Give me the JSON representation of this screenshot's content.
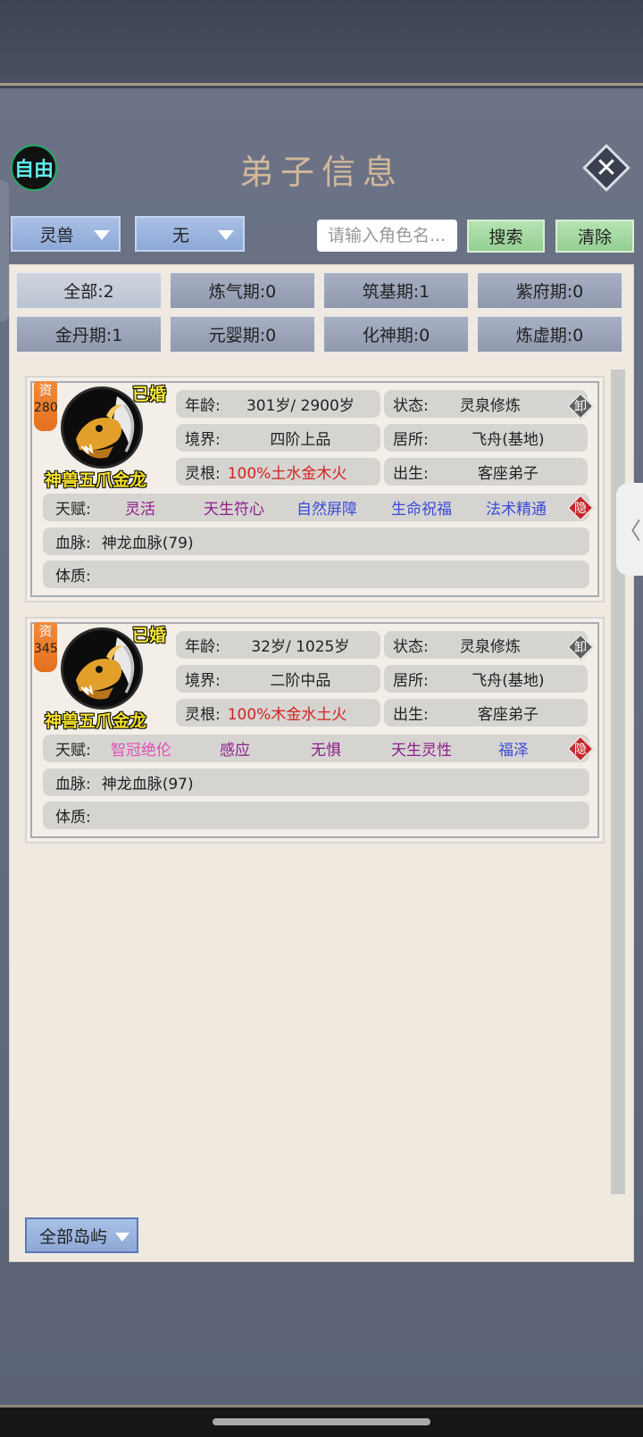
{
  "header": {
    "free_label": "自由",
    "title": "弟子信息",
    "close_label": "✕"
  },
  "filters": {
    "type_select": "灵兽",
    "second_select": "无",
    "search_placeholder": "请输入角色名...",
    "search_label": "搜索",
    "clear_label": "清除"
  },
  "realms": [
    {
      "label": "全部:2"
    },
    {
      "label": "炼气期:0"
    },
    {
      "label": "筑基期:1"
    },
    {
      "label": "紫府期:0"
    },
    {
      "label": "金丹期:1"
    },
    {
      "label": "元婴期:0"
    },
    {
      "label": "化神期:0"
    },
    {
      "label": "炼虚期:0"
    }
  ],
  "labels": {
    "age": "年龄:",
    "state": "状态:",
    "realm": "境界:",
    "residence": "居所:",
    "root": "灵根:",
    "birth": "出生:",
    "talent": "天赋:",
    "bloodline": "血脉:",
    "physique": "体质:",
    "unequip_badge": "卸",
    "hide_badge": "隐",
    "aptitude_prefix": "资",
    "married": "已婚"
  },
  "disciples": [
    {
      "aptitude": "280",
      "name": "神兽五爪金龙",
      "age": "301岁/ 2900岁",
      "state": "灵泉修炼",
      "realm": "四阶上品",
      "residence": "飞舟(基地)",
      "root": "100%土水金木火",
      "birth": "客座弟子",
      "talents": [
        "灵活",
        "天生符心",
        "自然屏障",
        "生命祝福",
        "法术精通"
      ],
      "talent_colors": [
        "purple",
        "purple",
        "blue",
        "blue",
        "blue"
      ],
      "bloodline": "神龙血脉(79)",
      "physique": ""
    },
    {
      "aptitude": "345",
      "name": "神兽五爪金龙",
      "age": "32岁/ 1025岁",
      "state": "灵泉修炼",
      "realm": "二阶中品",
      "residence": "飞舟(基地)",
      "root": "100%木金水土火",
      "birth": "客座弟子",
      "talents": [
        "智冠绝伦",
        "感应",
        "无惧",
        "天生灵性",
        "福泽"
      ],
      "talent_colors": [
        "pink",
        "purple",
        "purple",
        "purple",
        "blue"
      ],
      "bloodline": "神龙血脉(97)",
      "physique": ""
    }
  ],
  "footer": {
    "island_select": "全部岛屿"
  }
}
